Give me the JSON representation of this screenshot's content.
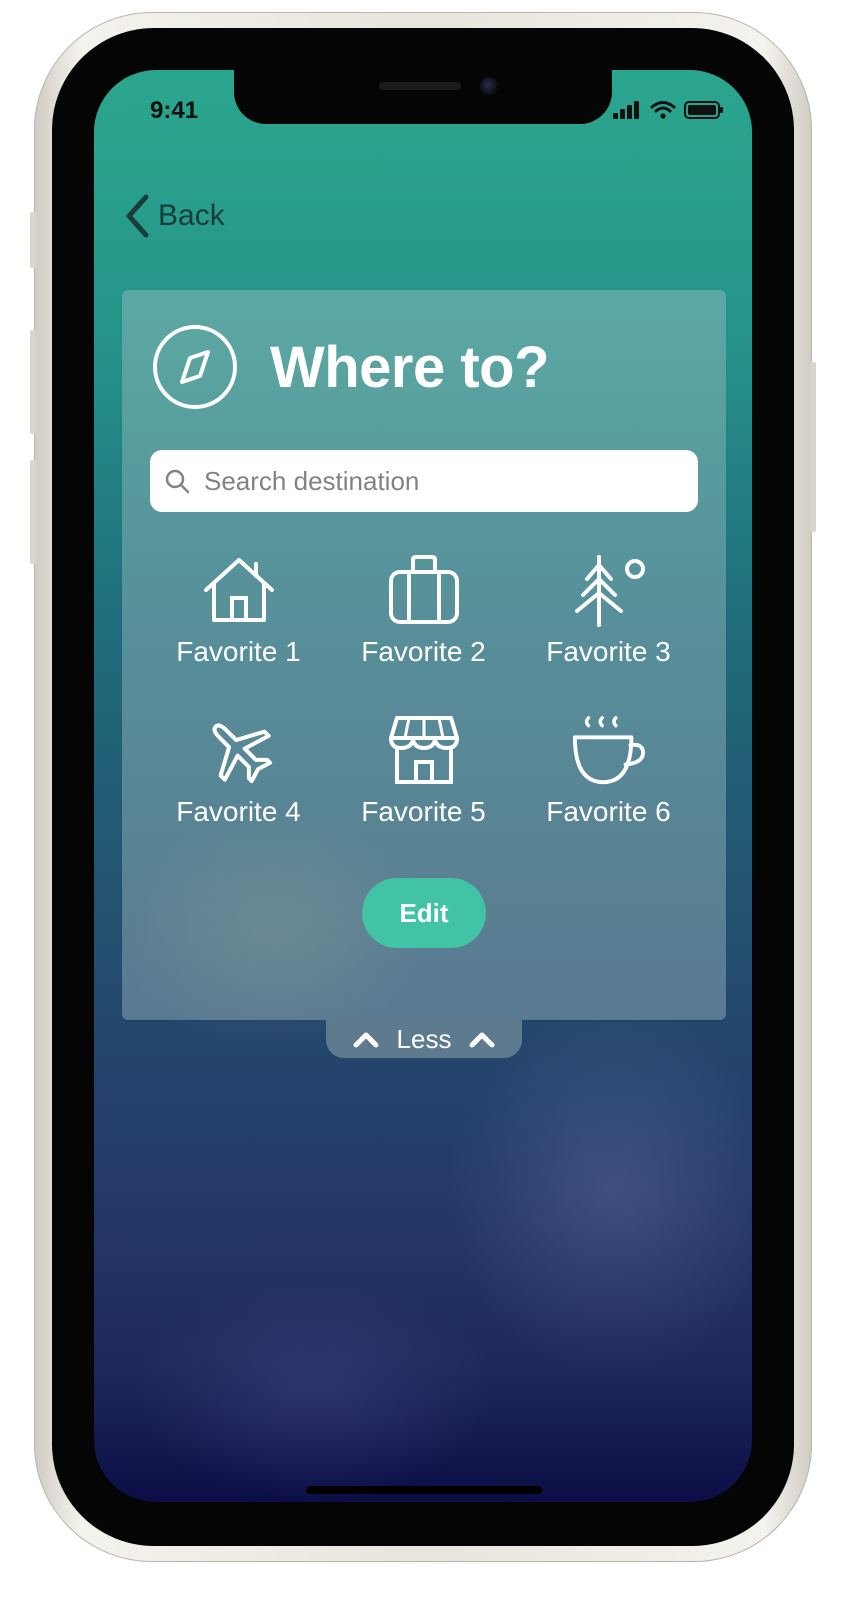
{
  "status_bar": {
    "time": "9:41",
    "icons": [
      "signal-icon",
      "wifi-icon",
      "battery-icon"
    ]
  },
  "nav": {
    "back_label": "Back",
    "back_icon": "chevron-left-icon"
  },
  "card": {
    "icon": "compass-icon",
    "title": "Where to?"
  },
  "search": {
    "placeholder": "Search destination",
    "icon": "search-icon"
  },
  "favorites": [
    {
      "label": "Favorite 1",
      "icon": "house-icon"
    },
    {
      "label": "Favorite 2",
      "icon": "suitcase-icon"
    },
    {
      "label": "Favorite 3",
      "icon": "tree-icon"
    },
    {
      "label": "Favorite 4",
      "icon": "airplane-icon"
    },
    {
      "label": "Favorite 5",
      "icon": "shop-icon"
    },
    {
      "label": "Favorite 6",
      "icon": "coffee-cup-icon"
    }
  ],
  "edit_button": {
    "label": "Edit"
  },
  "collapse": {
    "label": "Less",
    "icon": "chevron-up-icon"
  },
  "colors": {
    "accent": "#43c3a6",
    "header_teal": "#2ba68e",
    "bottom_navy": "#0c0d46"
  }
}
